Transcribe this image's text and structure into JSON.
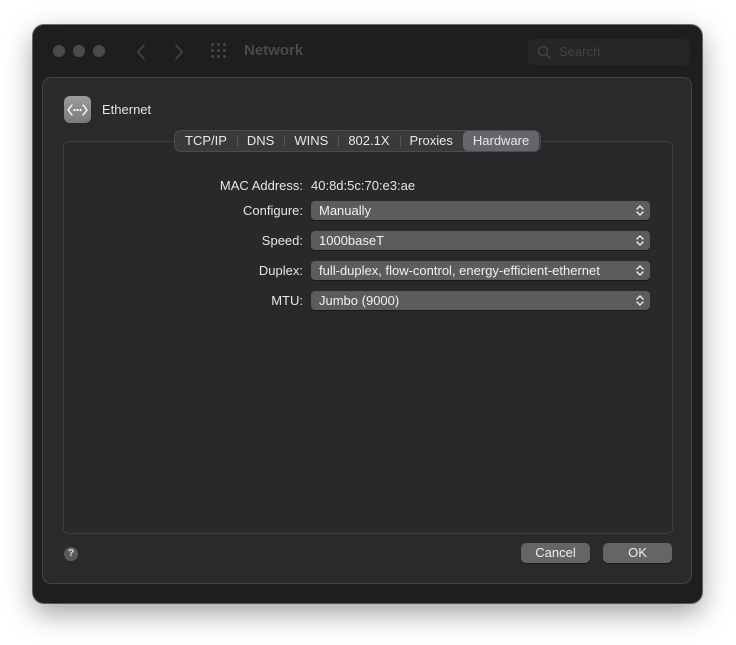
{
  "window": {
    "title": "Network",
    "search_placeholder": "Search"
  },
  "header": {
    "service_name": "Ethernet"
  },
  "tabs": [
    {
      "label": "TCP/IP"
    },
    {
      "label": "DNS"
    },
    {
      "label": "WINS"
    },
    {
      "label": "802.1X"
    },
    {
      "label": "Proxies"
    },
    {
      "label": "Hardware",
      "selected": true
    }
  ],
  "hardware": {
    "mac_label": "MAC Address:",
    "mac_value": "40:8d:5c:70:e3:ae",
    "configure_label": "Configure:",
    "configure_value": "Manually",
    "speed_label": "Speed:",
    "speed_value": "1000baseT",
    "duplex_label": "Duplex:",
    "duplex_value": "full-duplex, flow-control, energy-efficient-ethernet",
    "mtu_label": "MTU:",
    "mtu_value": "Jumbo (9000)"
  },
  "buttons": {
    "help": "?",
    "cancel": "Cancel",
    "ok": "OK"
  },
  "colors": {
    "window_bg": "#1e1e1e",
    "sheet_bg": "#2a2a2c",
    "selected_tab": "#66666a",
    "popup_bg": "#5c5c5f"
  }
}
